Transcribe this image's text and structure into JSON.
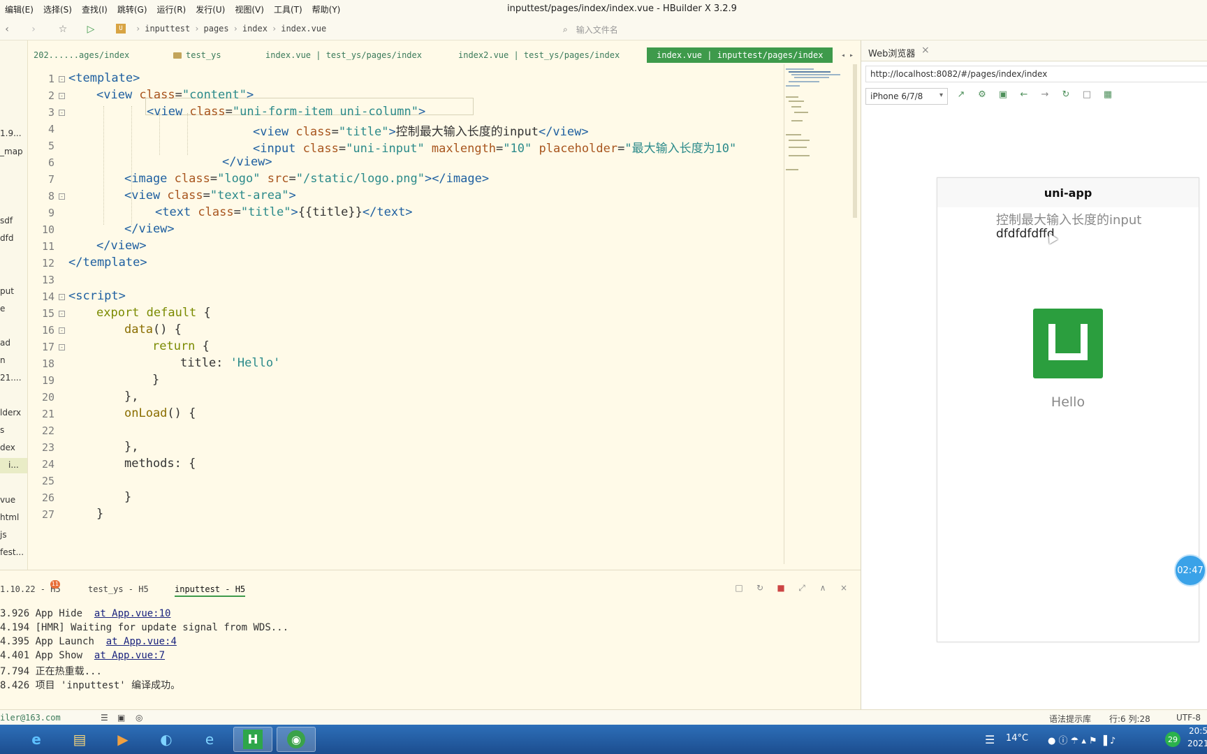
{
  "menu": [
    "编辑(E)",
    "选择(S)",
    "查找(I)",
    "跳转(G)",
    "运行(R)",
    "发行(U)",
    "视图(V)",
    "工具(T)",
    "帮助(Y)"
  ],
  "window_title": "inputtest/pages/index/index.vue - HBuilder X 3.2.9",
  "breadcrumb": [
    "inputtest",
    "pages",
    "index",
    "index.vue"
  ],
  "file_search_placeholder": "输入文件名",
  "sidebar_items": [
    "1.9...",
    "_map",
    "sdf",
    "dfd",
    "put",
    "e",
    "ad",
    "n",
    "21....",
    "lderx",
    "s",
    "dex",
    "i...",
    "vue",
    "html",
    "js",
    "fest..."
  ],
  "tabs": [
    {
      "label": "202......ages/index"
    },
    {
      "label": "test_ys"
    },
    {
      "label": "index.vue | test_ys/pages/index"
    },
    {
      "label": "index2.vue | test_ys/pages/index"
    },
    {
      "label": "index.vue | inputtest/pages/index"
    }
  ],
  "editor": {
    "line_numbers": [
      "1",
      "2",
      "3",
      "4",
      "5",
      "6",
      "7",
      "8",
      "9",
      "10",
      "11",
      "12",
      "13",
      "14",
      "15",
      "16",
      "17",
      "18",
      "19",
      "20",
      "21",
      "22",
      "23",
      "24",
      "25",
      "26",
      "27"
    ],
    "lines": {
      "l1": "<template>",
      "l2a": "<view ",
      "l2b": "class",
      "l2c": "=",
      "l2d": "\"content\"",
      "l2e": ">",
      "l3a": "<view ",
      "l3b": "class",
      "l3c": "=",
      "l3d": "\"uni-form-item uni-column\"",
      "l3e": ">",
      "l4a": "<view ",
      "l4b": "class",
      "l4c": "=",
      "l4d": "\"title\"",
      "l4e": ">",
      "l4f": "控制最大输入长度的input",
      "l4g": "</view>",
      "l5a": "<input ",
      "l5b": "class",
      "l5c": "=",
      "l5d": "\"uni-input\"",
      "l5e": " maxlength",
      "l5f": "=",
      "l5g": "\"10\"",
      "l5h": " placeholder",
      "l5i": "=",
      "l5j": "\"最大输入长度为10\"",
      "l6": "</view>",
      "l7a": "<image ",
      "l7b": "class",
      "l7c": "=",
      "l7d": "\"logo\"",
      "l7e": " src",
      "l7f": "=",
      "l7g": "\"/static/logo.png\"",
      "l7h": "></image>",
      "l8a": "<view ",
      "l8b": "class",
      "l8c": "=",
      "l8d": "\"text-area\"",
      "l8e": ">",
      "l9a": "<text ",
      "l9b": "class",
      "l9c": "=",
      "l9d": "\"title\"",
      "l9e": ">",
      "l9f": "{{title}}",
      "l9g": "</text>",
      "l10": "</view>",
      "l11": "</view>",
      "l12": "</template>",
      "l14": "<script>",
      "l15a": "export default",
      "l15b": " {",
      "l16a": "data",
      "l16b": "() {",
      "l17a": "return",
      "l17b": " {",
      "l18a": "title: ",
      "l18b": "'Hello'",
      "l19": "}",
      "l20": "},",
      "l21a": "onLoad",
      "l21b": "() {",
      "l23": "},",
      "l24": "methods: {",
      "l26": "}",
      "l27": "}"
    }
  },
  "browser": {
    "tab_title": "Web浏览器",
    "url": "http://localhost:8082/#/pages/index/index",
    "device": "iPhone 6/7/8",
    "phone": {
      "nav_title": "uni-app",
      "title_text": "控制最大输入长度的input",
      "input_value": "dfdfdfdffd",
      "hello": "Hello"
    },
    "timer": "02:47"
  },
  "console": {
    "tabs": [
      "1.10.22 - H5",
      "test_ys - H5",
      "inputtest - H5"
    ],
    "badge": "11",
    "lines": [
      {
        "time": "3.926",
        "msg": "App Hide  ",
        "link": "at App.vue:10"
      },
      {
        "time": "4.194",
        "msg": "[HMR] Waiting for update signal from WDS...",
        "link": ""
      },
      {
        "time": "4.395",
        "msg": "App Launch  ",
        "link": "at App.vue:4"
      },
      {
        "time": "4.401",
        "msg": "App Show  ",
        "link": "at App.vue:7"
      },
      {
        "time": "7.794",
        "msg": "正在热重载...",
        "link": ""
      },
      {
        "time": "8.426",
        "msg": "项目 'inputtest' 编译成功。",
        "link": ""
      }
    ]
  },
  "status": {
    "user": "iler@163.com",
    "hint": "语法提示库",
    "position": "行:6  列:28",
    "encoding": "UTF-8"
  },
  "taskbar": {
    "temperature": "14°C",
    "clock_time": "20:5",
    "clock_date": "2021",
    "notify_count": "29"
  }
}
